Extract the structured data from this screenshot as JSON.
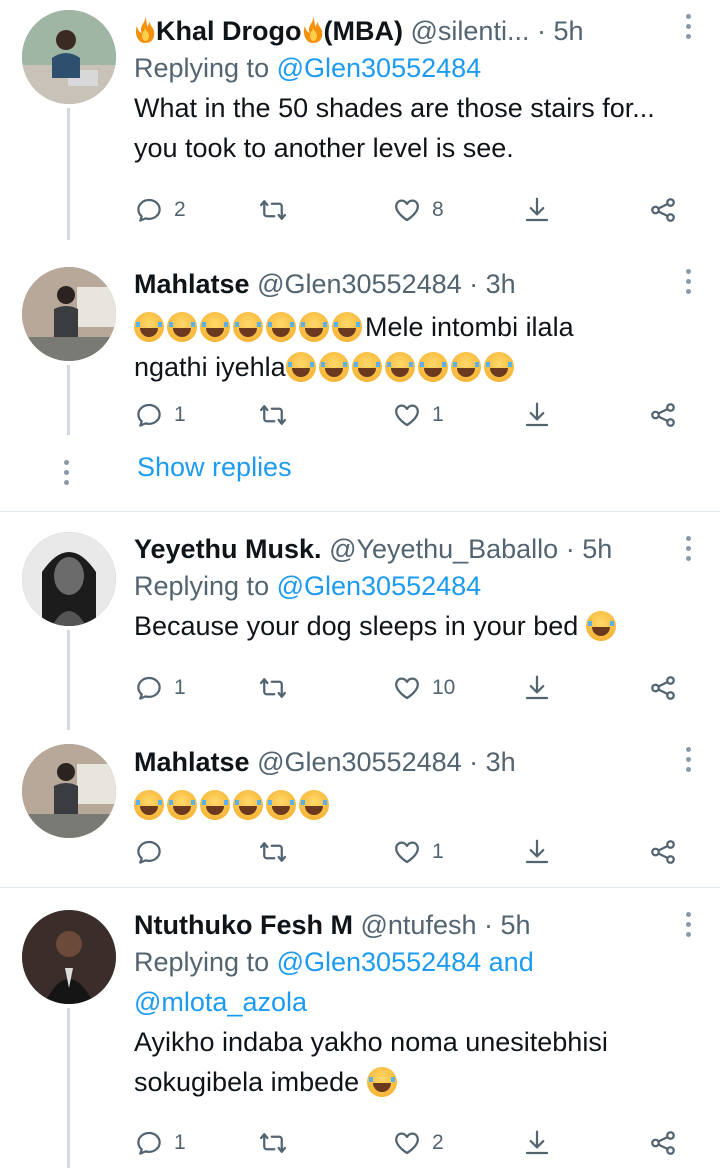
{
  "tweets": [
    {
      "name": "Khal Drogo",
      "name_suffix": "(MBA)",
      "handle": "@silenti...",
      "time": "· 5h",
      "replying_label": "Replying to ",
      "replying_to": "@Glen30552484",
      "body": "What in the 50 shades are those stairs for... you took to another level is see.",
      "reply_count": "2",
      "retweet_count": "",
      "like_count": "8"
    },
    {
      "name": "Mahlatse",
      "handle": "@Glen30552484",
      "time": "· 3h",
      "body_text_1": "Mele intombi ilala",
      "body_text_2": "ngathi iyehla",
      "reply_count": "1",
      "retweet_count": "",
      "like_count": "1"
    },
    {
      "name": "Yeyethu Musk.",
      "handle": "@Yeyethu_Baballo",
      "time": "· 5h",
      "replying_label": "Replying to ",
      "replying_to": "@Glen30552484",
      "body": "Because your dog sleeps in your bed",
      "reply_count": "1",
      "retweet_count": "",
      "like_count": "10"
    },
    {
      "name": "Mahlatse",
      "handle": "@Glen30552484",
      "time": "· 3h",
      "reply_count": "",
      "retweet_count": "",
      "like_count": "1"
    },
    {
      "name": "Ntuthuko Fesh M",
      "handle": "@ntufesh",
      "time": "· 5h",
      "replying_label": "Replying to ",
      "replying_to": "@Glen30552484 and @mlota_azola",
      "body": "Ayikho indaba yakho noma unesitebhisi sokugibela imbede",
      "reply_count": "1",
      "retweet_count": "",
      "like_count": "2"
    }
  ],
  "show_replies": "Show replies",
  "colors": {
    "accent": "#1d9bf0",
    "muted": "#536471",
    "divider": "#e1e8ed"
  }
}
